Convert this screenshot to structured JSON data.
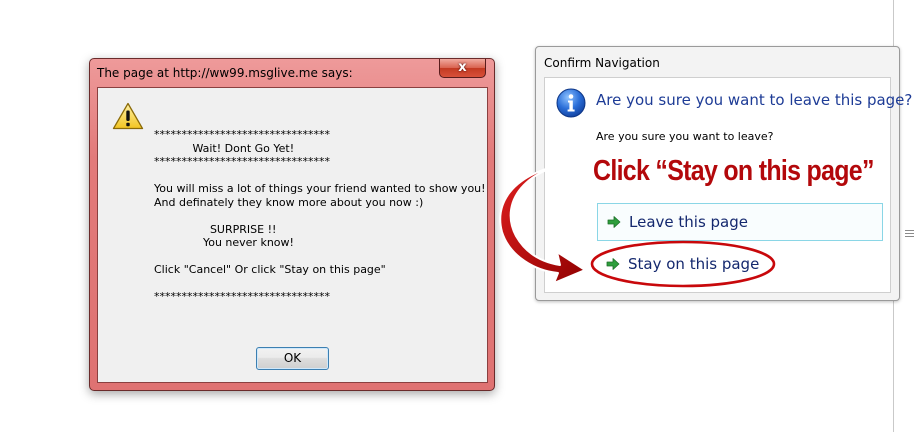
{
  "alert_dialog": {
    "title": "The page at http://ww99.msglive.me says:",
    "close_label": "x",
    "lines": [
      "********************************",
      "           Wait! Dont Go Yet!",
      "********************************",
      "",
      "You will miss a lot of things your friend wanted to show you!",
      "And definately they know more about you now :)",
      "",
      "                SURPRISE !!",
      "              You never know!",
      "",
      "Click \"Cancel\" Or click \"Stay on this page\"",
      "",
      "********************************"
    ],
    "ok_label": "OK",
    "icon": "warning-icon"
  },
  "confirm_dialog": {
    "title": "Confirm Navigation",
    "heading": "Are you sure you want to leave this page?",
    "question": "Are you sure you want to leave?",
    "leave_label": "Leave this page",
    "stay_label": "Stay on this page",
    "icon": "info-icon"
  },
  "annotation": {
    "callout_text": "Click “Stay on this page”",
    "color": "#b3080b"
  }
}
